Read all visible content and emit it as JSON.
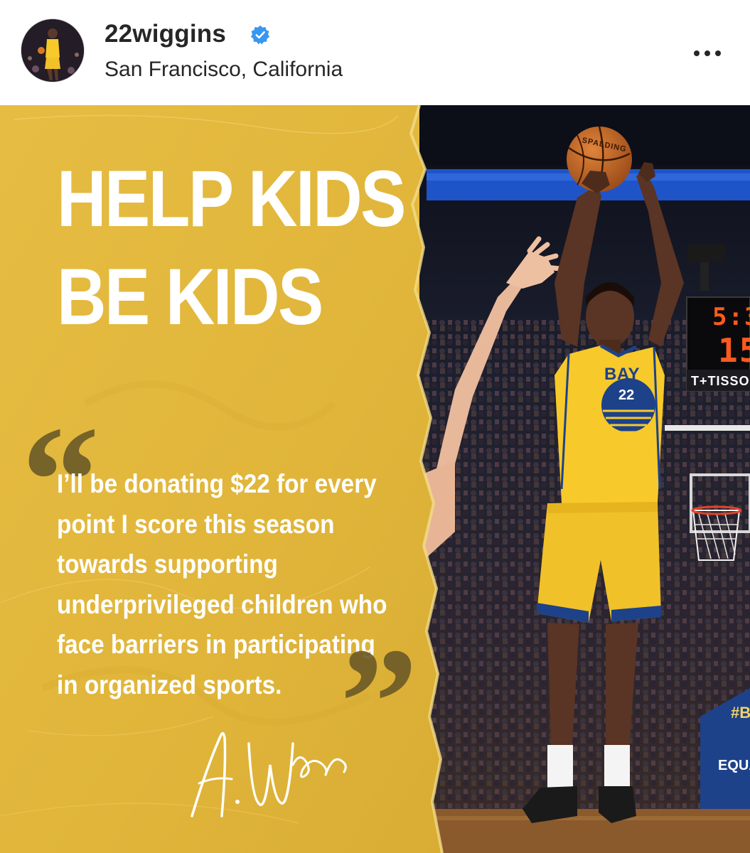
{
  "post": {
    "username": "22wiggins",
    "verified": true,
    "location": "San Francisco, California",
    "more_icon": "more-horizontal-icon"
  },
  "graphic": {
    "headline_line1": "HELP KIDS",
    "headline_line2": "BE KIDS",
    "quote_open_mark": "“",
    "quote_close_mark": "”",
    "quote_lines": [
      "I’ll be donating $22 for every",
      "point I score this season",
      "towards supporting",
      "underprivileged children who",
      "face barriers in participating",
      "in organized sports."
    ],
    "signature": "A. Wiggins",
    "scoreboard_clock": "5:3",
    "scoreboard_shot": "15",
    "scoreboard_brand": "T+TISSO",
    "jersey_team": "BAY",
    "jersey_number": "22",
    "ball_brand": "SPALDING",
    "banner_hash": "#B",
    "banner_equality": "EQUALITY"
  },
  "colors": {
    "panel_yellow": "#e3b83d",
    "quote_mark": "#6b5a27",
    "verified_blue": "#3897f0",
    "warriors_blue": "#1d428a",
    "warriors_gold": "#f7c92a",
    "scoreboard_orange": "#ff5a1f"
  }
}
